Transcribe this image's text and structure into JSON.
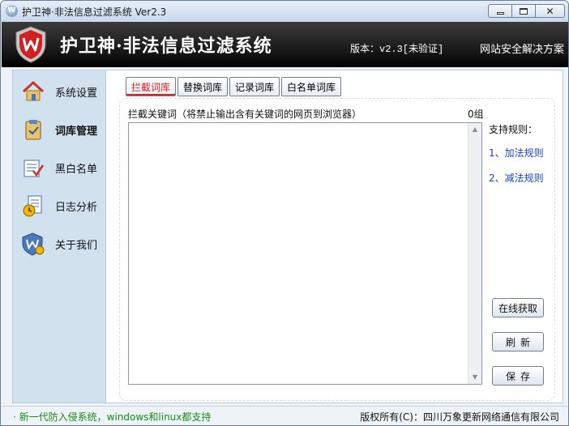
{
  "window": {
    "title": "护卫神·非法信息过滤系统 Ver2.3",
    "app_icon_letter": "W"
  },
  "header": {
    "app_name": "护卫神·非法信息过滤系统",
    "version": "版本：v2.3[未验证]",
    "tagline": "网站安全解决方案"
  },
  "sidebar": {
    "items": [
      {
        "label": "系统设置",
        "icon": "house-icon"
      },
      {
        "label": "词库管理",
        "icon": "clipboard-icon",
        "active": true
      },
      {
        "label": "黑白名单",
        "icon": "notepad-check-icon"
      },
      {
        "label": "日志分析",
        "icon": "log-clock-icon"
      },
      {
        "label": "关于我们",
        "icon": "shield-user-icon"
      }
    ]
  },
  "tabs": [
    {
      "label": "拦截词库",
      "active": true
    },
    {
      "label": "替换词库"
    },
    {
      "label": "记录词库"
    },
    {
      "label": "白名单词库"
    }
  ],
  "keyword_panel": {
    "label": "拦截关键词（将禁止输出含有关键词的网页到浏览器）",
    "count": "0组",
    "content": ""
  },
  "rules": {
    "title": "支持规则：",
    "items": [
      "1、加法规则",
      "2、减法规则"
    ]
  },
  "buttons": {
    "online": "在线获取",
    "refresh": "刷新",
    "save": "保存"
  },
  "status": {
    "left": "· 新一代防入侵系统，windows和linux都支持",
    "right": "版权所有(C)：四川万象更新网络通信有限公司"
  },
  "colors": {
    "header_bg": "#1a1a1a",
    "sidebar_bg": "#d2e1ee",
    "active_tab": "#e02020",
    "link": "#1a3fbf",
    "status_green": "#1a8a1a"
  }
}
